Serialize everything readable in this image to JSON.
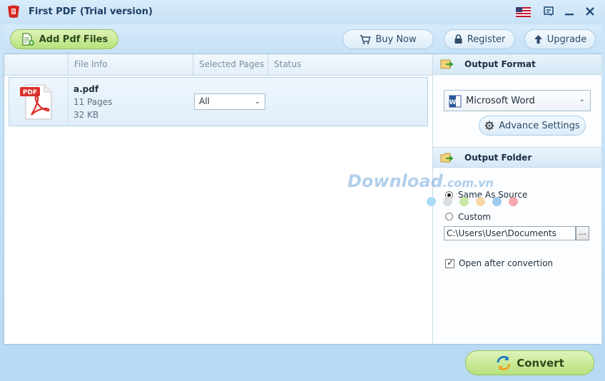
{
  "window": {
    "title": "First PDF (Trial version)"
  },
  "toolbar": {
    "add_label": "Add Pdf Files",
    "buy_label": "Buy Now",
    "register_label": "Register",
    "upgrade_label": "Upgrade"
  },
  "grid": {
    "columns": [
      "File Info",
      "Selected Pages",
      "Status"
    ],
    "rows": [
      {
        "icon": "pdf-icon",
        "icon_text": "PDF",
        "name": "a.pdf",
        "pages": "11 Pages",
        "size": "32 KB",
        "selected_pages": "All",
        "status": ""
      }
    ]
  },
  "output_format": {
    "header": "Output Format",
    "selected": "Microsoft Word",
    "word_icon_text": "W",
    "advance_label": "Advance Settings"
  },
  "output_folder": {
    "header": "Output Folder",
    "same_as_source": "Same As Source",
    "custom": "Custom",
    "path": "C:\\Users\\User\\Documents",
    "browse": "...",
    "open_after": "Open after convertion",
    "selected_option": "same_as_source",
    "open_after_checked": true
  },
  "watermark": {
    "main": "Download",
    "suffix": ".com.vn"
  },
  "convert_label": "Convert",
  "colors": {
    "accent_green": "#b7e17b",
    "pdf_red": "#d9302b",
    "title_blue": "#1e3f66"
  }
}
